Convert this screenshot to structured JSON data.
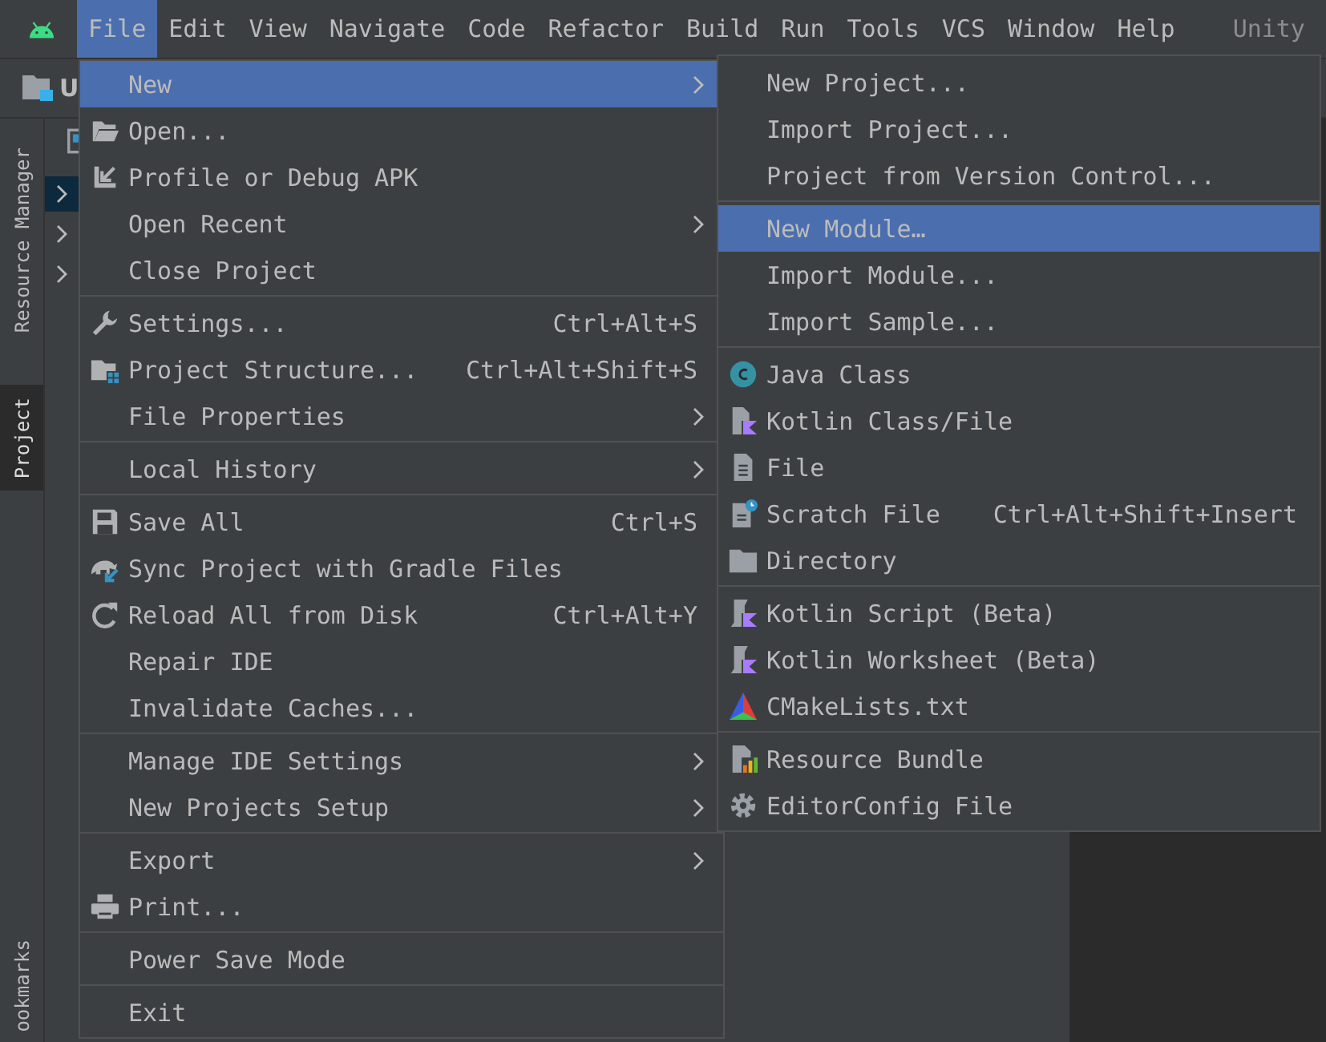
{
  "menubar": {
    "items": [
      {
        "label": "File",
        "selected": true
      },
      {
        "label": "Edit",
        "selected": false
      },
      {
        "label": "View",
        "selected": false
      },
      {
        "label": "Navigate",
        "selected": false
      },
      {
        "label": "Code",
        "selected": false
      },
      {
        "label": "Refactor",
        "selected": false
      },
      {
        "label": "Build",
        "selected": false
      },
      {
        "label": "Run",
        "selected": false
      },
      {
        "label": "Tools",
        "selected": false
      },
      {
        "label": "VCS",
        "selected": false
      },
      {
        "label": "Window",
        "selected": false
      },
      {
        "label": "Help",
        "selected": false
      }
    ],
    "project_title": "Unity"
  },
  "toolbar": {
    "project": "U"
  },
  "side_tabs": [
    {
      "label": "Resource Manager",
      "selected": false
    },
    {
      "label": "Project",
      "selected": true
    },
    {
      "label": "ookmarks",
      "selected": false
    }
  ],
  "tree_rows": [
    {
      "selected": true
    },
    {
      "selected": false
    },
    {
      "selected": false
    }
  ],
  "file_menu": [
    [
      {
        "label": "New",
        "submenu": true,
        "selected": true
      },
      {
        "label": "Open...",
        "submenu": false,
        "selected": false
      },
      {
        "label": "Profile or Debug APK",
        "submenu": false,
        "selected": false
      },
      {
        "label": "Open Recent",
        "submenu": true,
        "selected": false
      },
      {
        "label": "Close Project",
        "submenu": false,
        "selected": false
      }
    ],
    [
      {
        "label": "Settings...",
        "shortcut": "Ctrl+Alt+S",
        "submenu": false,
        "selected": false
      },
      {
        "label": "Project Structure...",
        "shortcut": "Ctrl+Alt+Shift+S",
        "submenu": false,
        "selected": false
      },
      {
        "label": "File Properties",
        "submenu": true,
        "selected": false
      }
    ],
    [
      {
        "label": "Local History",
        "submenu": true,
        "selected": false
      }
    ],
    [
      {
        "label": "Save All",
        "shortcut": "Ctrl+S",
        "submenu": false,
        "selected": false
      },
      {
        "label": "Sync Project with Gradle Files",
        "submenu": false,
        "selected": false
      },
      {
        "label": "Reload All from Disk",
        "shortcut": "Ctrl+Alt+Y",
        "submenu": false,
        "selected": false
      },
      {
        "label": "Repair IDE",
        "submenu": false,
        "selected": false
      },
      {
        "label": "Invalidate Caches...",
        "submenu": false,
        "selected": false
      }
    ],
    [
      {
        "label": "Manage IDE Settings",
        "submenu": true,
        "selected": false
      },
      {
        "label": "New Projects Setup",
        "submenu": true,
        "selected": false
      }
    ],
    [
      {
        "label": "Export",
        "submenu": true,
        "selected": false
      },
      {
        "label": "Print...",
        "submenu": false,
        "selected": false
      }
    ],
    [
      {
        "label": "Power Save Mode",
        "submenu": false,
        "selected": false
      }
    ],
    [
      {
        "label": "Exit",
        "submenu": false,
        "selected": false
      }
    ]
  ],
  "new_submenu": [
    [
      {
        "label": "New Project...",
        "selected": false
      },
      {
        "label": "Import Project...",
        "selected": false
      },
      {
        "label": "Project from Version Control...",
        "selected": false
      }
    ],
    [
      {
        "label": "New Module…",
        "selected": true
      },
      {
        "label": "Import Module...",
        "selected": false
      },
      {
        "label": "Import Sample...",
        "selected": false
      }
    ],
    [
      {
        "label": "Java Class",
        "selected": false
      },
      {
        "label": "Kotlin Class/File",
        "selected": false
      },
      {
        "label": "File",
        "selected": false
      },
      {
        "label": "Scratch File",
        "shortcut": "Ctrl+Alt+Shift+Insert",
        "selected": false
      },
      {
        "label": "Directory",
        "selected": false
      }
    ],
    [
      {
        "label": "Kotlin Script (Beta)",
        "selected": false
      },
      {
        "label": "Kotlin Worksheet (Beta)",
        "selected": false
      },
      {
        "label": "CMakeLists.txt",
        "selected": false
      }
    ],
    [
      {
        "label": "Resource Bundle",
        "selected": false
      },
      {
        "label": "EditorConfig File",
        "selected": false
      }
    ]
  ]
}
